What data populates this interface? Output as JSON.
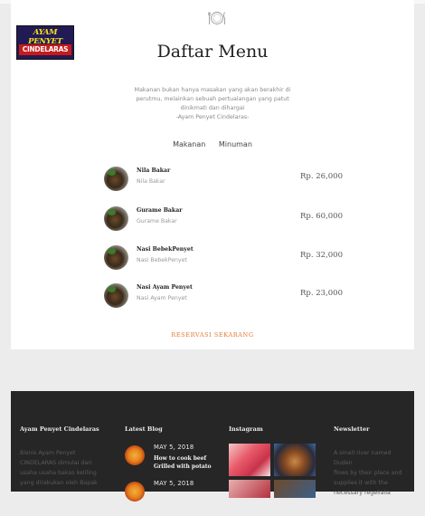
{
  "logo": {
    "line1": "AYAM PENYET",
    "line2": "CINDELARAS"
  },
  "header": {
    "icon": "plate-cutlery-icon",
    "title": "Daftar Menu"
  },
  "quote": {
    "lines": [
      "Makanan bukan hanya masakan yang akan berakhir di",
      "perutmu, melainkan sebuah pertualangan yang patut",
      "dinikmati dan dihargai",
      "-Ayam Penyet Cindelaras-"
    ]
  },
  "tabs": [
    "Makanan",
    "Minuman"
  ],
  "menu": [
    {
      "name": "Nila Bakar",
      "desc": "Nila Bakar",
      "price": "Rp. 26,000"
    },
    {
      "name": "Gurame Bakar",
      "desc": "Gurame Bakar",
      "price": "Rp. 60,000"
    },
    {
      "name": "Nasi BebekPenyet",
      "desc": "Nasi BebekPenyet",
      "price": "Rp. 32,000"
    },
    {
      "name": "Nasi Ayam Penyet",
      "desc": "Nasi Ayam Penyet",
      "price": "Rp. 23,000"
    }
  ],
  "reserve_label": "RESERVASI SEKARANG",
  "footer": {
    "about": {
      "heading": "Ayam Penyet Cindelaras",
      "lines": [
        "Bisnis Ayam Penyet",
        "CINDELARAS dimulai dari",
        "usaha usaha bakso keliling",
        "yang dirakukan oleh Bapak"
      ]
    },
    "blog": {
      "heading": "Latest Blog",
      "posts": [
        {
          "date": "MAY 5, 2018",
          "title": "How to cook beef Grilled with potato"
        },
        {
          "date": "MAY 5, 2018",
          "title": ""
        }
      ]
    },
    "instagram": {
      "heading": "Instagram"
    },
    "newsletter": {
      "heading": "Newsletter",
      "lines": [
        "A small river named Duden",
        "flows by their place and",
        "supplies it with the",
        "necessary regelialia"
      ]
    }
  },
  "colors": {
    "accent": "#e4772e",
    "footer_bg": "#262626",
    "page_bg": "#ececec"
  }
}
